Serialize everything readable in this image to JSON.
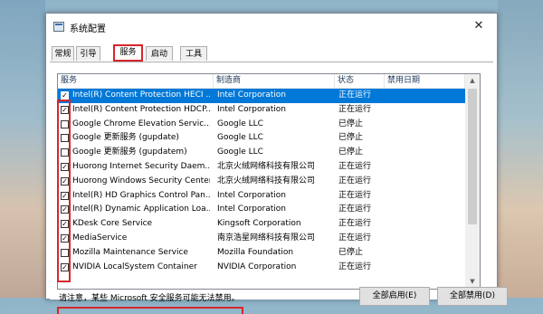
{
  "window": {
    "title": "系统配置",
    "close_glyph": "✕"
  },
  "tabs": [
    {
      "label": "常规",
      "active": false
    },
    {
      "label": "引导",
      "active": false
    },
    {
      "label": "服务",
      "active": true
    },
    {
      "label": "启动",
      "active": false
    },
    {
      "label": "工具",
      "active": false
    }
  ],
  "table": {
    "columns": [
      "服务",
      "制造商",
      "状态",
      "禁用日期"
    ],
    "rows": [
      {
        "checked": true,
        "name": "Intel(R) Content Protection HECI ...",
        "manufacturer": "Intel Corporation",
        "status": "正在运行",
        "date": "",
        "selected": true
      },
      {
        "checked": true,
        "name": "Intel(R) Content Protection HDCP...",
        "manufacturer": "Intel Corporation",
        "status": "正在运行",
        "date": ""
      },
      {
        "checked": false,
        "name": "Google Chrome Elevation Servic...",
        "manufacturer": "Google LLC",
        "status": "已停止",
        "date": ""
      },
      {
        "checked": false,
        "name": "Google 更新服务 (gupdate)",
        "manufacturer": "Google LLC",
        "status": "已停止",
        "date": ""
      },
      {
        "checked": false,
        "name": "Google 更新服务 (gupdatem)",
        "manufacturer": "Google LLC",
        "status": "已停止",
        "date": ""
      },
      {
        "checked": true,
        "name": "Huorong Internet Security Daem...",
        "manufacturer": "北京火绒网络科技有限公司",
        "status": "正在运行",
        "date": ""
      },
      {
        "checked": true,
        "name": "Huorong Windows Security Center",
        "manufacturer": "北京火绒网络科技有限公司",
        "status": "正在运行",
        "date": ""
      },
      {
        "checked": true,
        "name": "Intel(R) HD Graphics Control Pan...",
        "manufacturer": "Intel Corporation",
        "status": "正在运行",
        "date": ""
      },
      {
        "checked": true,
        "name": "Intel(R) Dynamic Application Loa...",
        "manufacturer": "Intel Corporation",
        "status": "正在运行",
        "date": ""
      },
      {
        "checked": true,
        "name": "KDesk Core Service",
        "manufacturer": "Kingsoft Corporation",
        "status": "正在运行",
        "date": ""
      },
      {
        "checked": true,
        "name": "MediaService",
        "manufacturer": "南京浩星网络科技有限公司",
        "status": "正在运行",
        "date": ""
      },
      {
        "checked": false,
        "name": "Mozilla Maintenance Service",
        "manufacturer": "Mozilla Foundation",
        "status": "已停止",
        "date": ""
      },
      {
        "checked": true,
        "name": "NVIDIA LocalSystem Container",
        "manufacturer": "NVIDIA Corporation",
        "status": "正在运行",
        "date": ""
      }
    ]
  },
  "note": "请注意，某些 Microsoft 安全服务可能无法禁用。",
  "buttons": {
    "enable_all": "全部启用(E)",
    "disable_all": "全部禁用(D)"
  },
  "colors": {
    "highlight": "#d7262b",
    "selection": "#0078d7"
  },
  "icons": {
    "check": "✓",
    "scroll_up": "▲",
    "scroll_down": "▼"
  }
}
